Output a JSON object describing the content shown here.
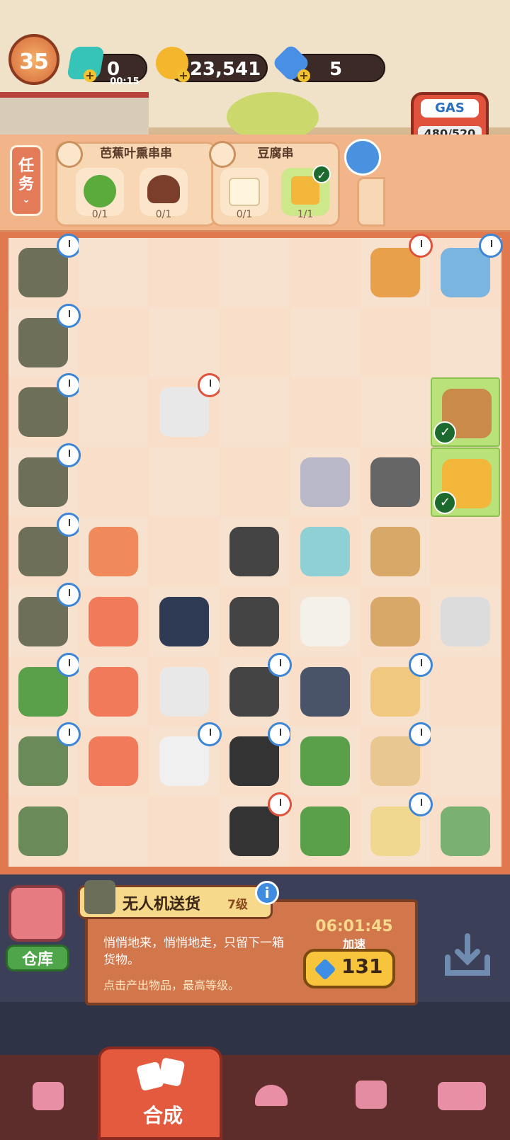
{
  "top_bar": {
    "level": "35",
    "energy": {
      "value": "0",
      "timer": "00:15"
    },
    "coins": {
      "value": "23,541"
    },
    "gems": {
      "value": "5"
    }
  },
  "tasks": {
    "tab_label": "任务",
    "orders": [
      {
        "title": "芭蕉叶熏串串",
        "items": [
          {
            "icon": "broccoli-icon",
            "count": "0/1"
          },
          {
            "icon": "mushroom-icon",
            "count": "0/1"
          }
        ]
      },
      {
        "title": "豆腐串",
        "items": [
          {
            "icon": "tofu-icon",
            "count": "0/1"
          },
          {
            "icon": "takeout-bag-icon",
            "count": "1/1"
          }
        ]
      }
    ]
  },
  "gas": {
    "label": "GAS",
    "value": "480/520",
    "fill": 0.923
  },
  "info": {
    "title": "无人机送货",
    "level": "7级",
    "description": "悄悄地来，悄悄地走，只留下一箱货物。",
    "subtext": "点击产出物品，最高等级。",
    "timer": "06:01:45",
    "speed_label": "加速",
    "speed_cost": "131"
  },
  "warehouse": {
    "label": "仓库"
  },
  "nav": {
    "merge_label": "合成"
  },
  "colors": {
    "board": "#e07a4e",
    "accent": "#f7c43c",
    "check": "#1d6a2e",
    "gem": "#3e8ee6"
  }
}
